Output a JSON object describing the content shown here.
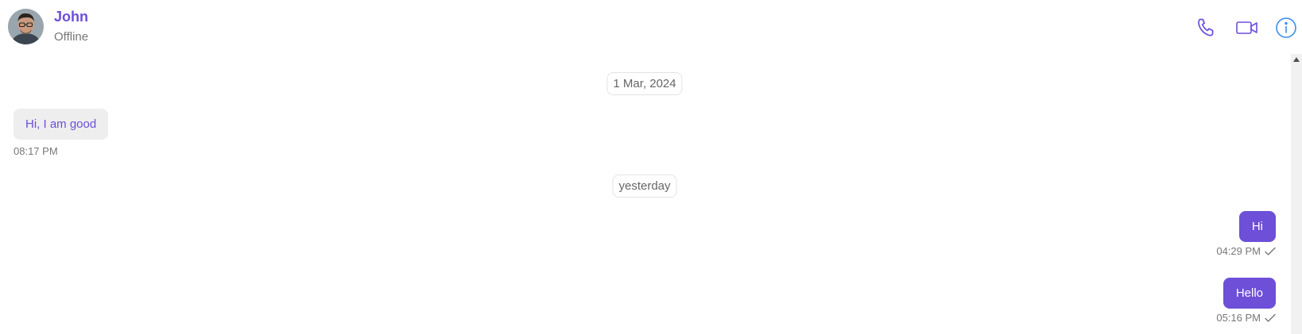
{
  "header": {
    "contact_name": "John",
    "status": "Offline",
    "icons": [
      "phone-icon",
      "video-icon",
      "info-icon"
    ]
  },
  "messages": {
    "date_separators": [
      "1 Mar, 2024",
      "yesterday"
    ],
    "incoming": [
      {
        "text": "Hi, I am good",
        "time": "08:17 PM"
      }
    ],
    "outgoing": [
      {
        "text": "Hi",
        "time": "04:29 PM",
        "status_icon": "check-icon"
      },
      {
        "text": "Hello",
        "time": "05:16 PM",
        "status_icon": "check-icon"
      }
    ]
  },
  "colors": {
    "accent": "#6d4fd8",
    "info_icon": "#3b8df0",
    "incoming_bubble": "#eeeeee",
    "muted_text": "#777777"
  }
}
